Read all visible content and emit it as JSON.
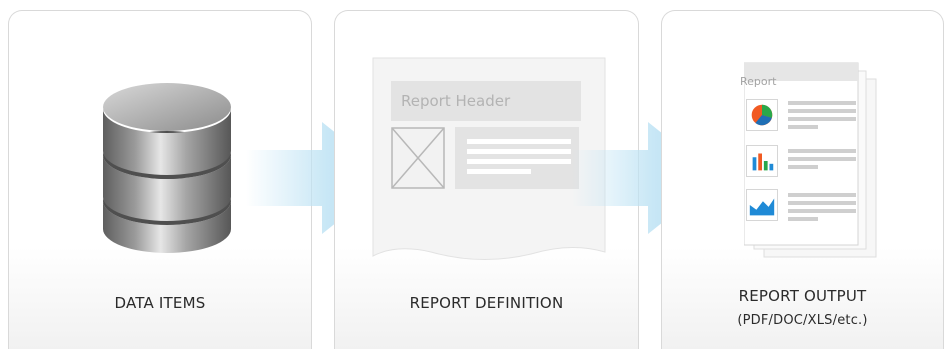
{
  "panels": [
    {
      "caption": "DATA ITEMS"
    },
    {
      "caption": "REPORT DEFINITION",
      "doc_header": "Report Header"
    },
    {
      "caption": "REPORT OUTPUT",
      "caption_sub": "(PDF/DOC/XLS/etc.)",
      "doc_label": "Report"
    }
  ],
  "colors": {
    "arrow": "#bfe3f4",
    "database": "#8a8a8a",
    "pie_orange": "#f15a22",
    "pie_blue": "#1f6fb5",
    "pie_green": "#2aa84a",
    "bar_blue": "#1f8ad6"
  },
  "icons": [
    "database-icon",
    "arrow-right-icon",
    "image-placeholder-icon",
    "pie-chart-icon",
    "bar-chart-icon",
    "area-chart-icon"
  ]
}
